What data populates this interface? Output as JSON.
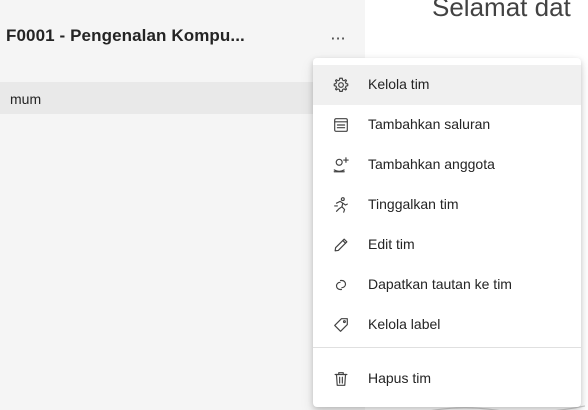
{
  "team": {
    "title": "F0001 - Pengenalan Kompu...",
    "more_label": "···",
    "channel_label": "mum"
  },
  "main": {
    "welcome_text": "Selamat dat"
  },
  "menu": {
    "items": [
      {
        "label": "Kelola tim",
        "icon": "gear-icon"
      },
      {
        "label": "Tambahkan saluran",
        "icon": "channel-list-icon"
      },
      {
        "label": "Tambahkan anggota",
        "icon": "add-person-icon"
      },
      {
        "label": "Tinggalkan tim",
        "icon": "leave-walk-icon"
      },
      {
        "label": "Edit tim",
        "icon": "pencil-icon"
      },
      {
        "label": "Dapatkan tautan ke tim",
        "icon": "link-icon"
      },
      {
        "label": "Kelola label",
        "icon": "tag-icon"
      },
      {
        "label": "Hapus tim",
        "icon": "trash-icon"
      }
    ]
  },
  "colors": {
    "menu_hover": "#f0f0f0",
    "left_panel": "#f5f5f5",
    "selected_channel": "#e9e9e9",
    "text": "#242424"
  }
}
